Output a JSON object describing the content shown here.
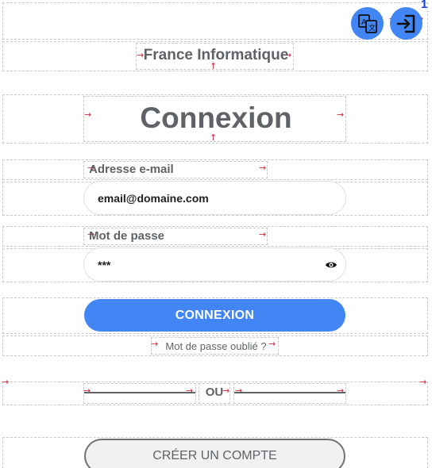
{
  "header": {
    "translate_icon": "translate-icon",
    "logout_icon": "logout-icon",
    "badge": "1"
  },
  "brand": {
    "name": "France Informatique"
  },
  "page": {
    "title": "Connexion"
  },
  "form": {
    "email_label": "Adresse e-mail",
    "email_value": "email@domaine.com",
    "password_label": "Mot de passe",
    "password_value": "***",
    "password_toggle_icon": "eye-icon",
    "submit_label": "CONNEXION",
    "forgot_label": "Mot de passe oublié ?",
    "or_label": "OU",
    "create_account_label": "CRÉER UN COMPTE"
  },
  "colors": {
    "accent": "#4285f4",
    "text": "#5f6368",
    "guide": "#c9c9c9",
    "guide_arrow": "#d6263a"
  }
}
